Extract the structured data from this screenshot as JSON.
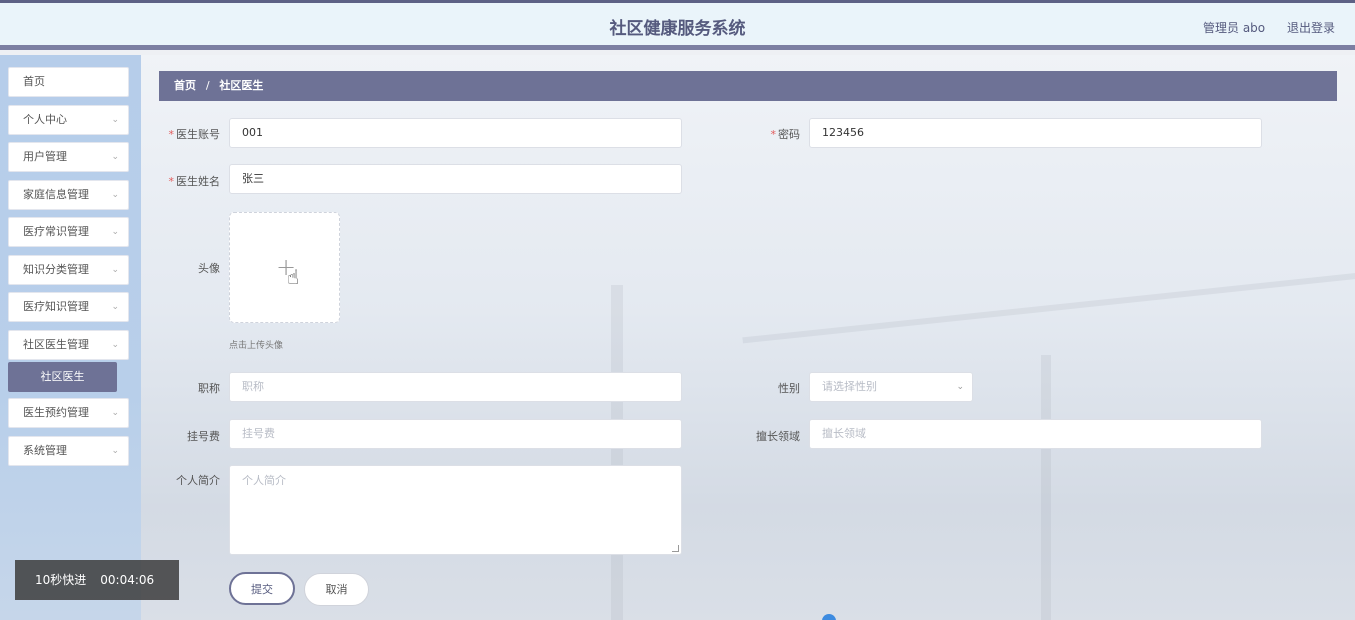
{
  "header": {
    "title": "社区健康服务系统",
    "user_label": "管理员 abo",
    "logout_label": "退出登录"
  },
  "sidebar": {
    "items": [
      {
        "label": "首页",
        "has_chevron": false
      },
      {
        "label": "个人中心",
        "has_chevron": true
      },
      {
        "label": "用户管理",
        "has_chevron": true
      },
      {
        "label": "家庭信息管理",
        "has_chevron": true
      },
      {
        "label": "医疗常识管理",
        "has_chevron": true
      },
      {
        "label": "知识分类管理",
        "has_chevron": true
      },
      {
        "label": "医疗知识管理",
        "has_chevron": true
      },
      {
        "label": "社区医生管理",
        "has_chevron": true
      },
      {
        "label": "医生预约管理",
        "has_chevron": true
      },
      {
        "label": "系统管理",
        "has_chevron": true
      }
    ],
    "active_subitem": "社区医生"
  },
  "breadcrumb": {
    "home": "首页",
    "separator": "/",
    "current": "社区医生"
  },
  "form": {
    "account": {
      "label": "医生账号",
      "value": "001",
      "required": true
    },
    "password": {
      "label": "密码",
      "value": "123456",
      "required": true
    },
    "name": {
      "label": "医生姓名",
      "value": "张三",
      "required": true
    },
    "avatar": {
      "label": "头像",
      "tip": "点击上传头像"
    },
    "title": {
      "label": "职称",
      "placeholder": "职称"
    },
    "gender": {
      "label": "性别",
      "placeholder": "请选择性别"
    },
    "fee": {
      "label": "挂号费",
      "placeholder": "挂号费"
    },
    "specialty": {
      "label": "擅长领域",
      "placeholder": "擅长领域"
    },
    "intro": {
      "label": "个人简介",
      "placeholder": "个人简介"
    },
    "submit_label": "提交",
    "cancel_label": "取消"
  },
  "overlay": {
    "speed_label": "10秒快进",
    "time": "00:04:06"
  },
  "icons": {
    "chevron": "chevron-down-icon",
    "plus": "plus-icon",
    "cursor": "hand-pointer-icon"
  },
  "colors": {
    "accent": "#6e7296",
    "header_bg": "#eaf4fa",
    "sidebar_bg": "#b6cdea",
    "required": "#e25b5b"
  }
}
